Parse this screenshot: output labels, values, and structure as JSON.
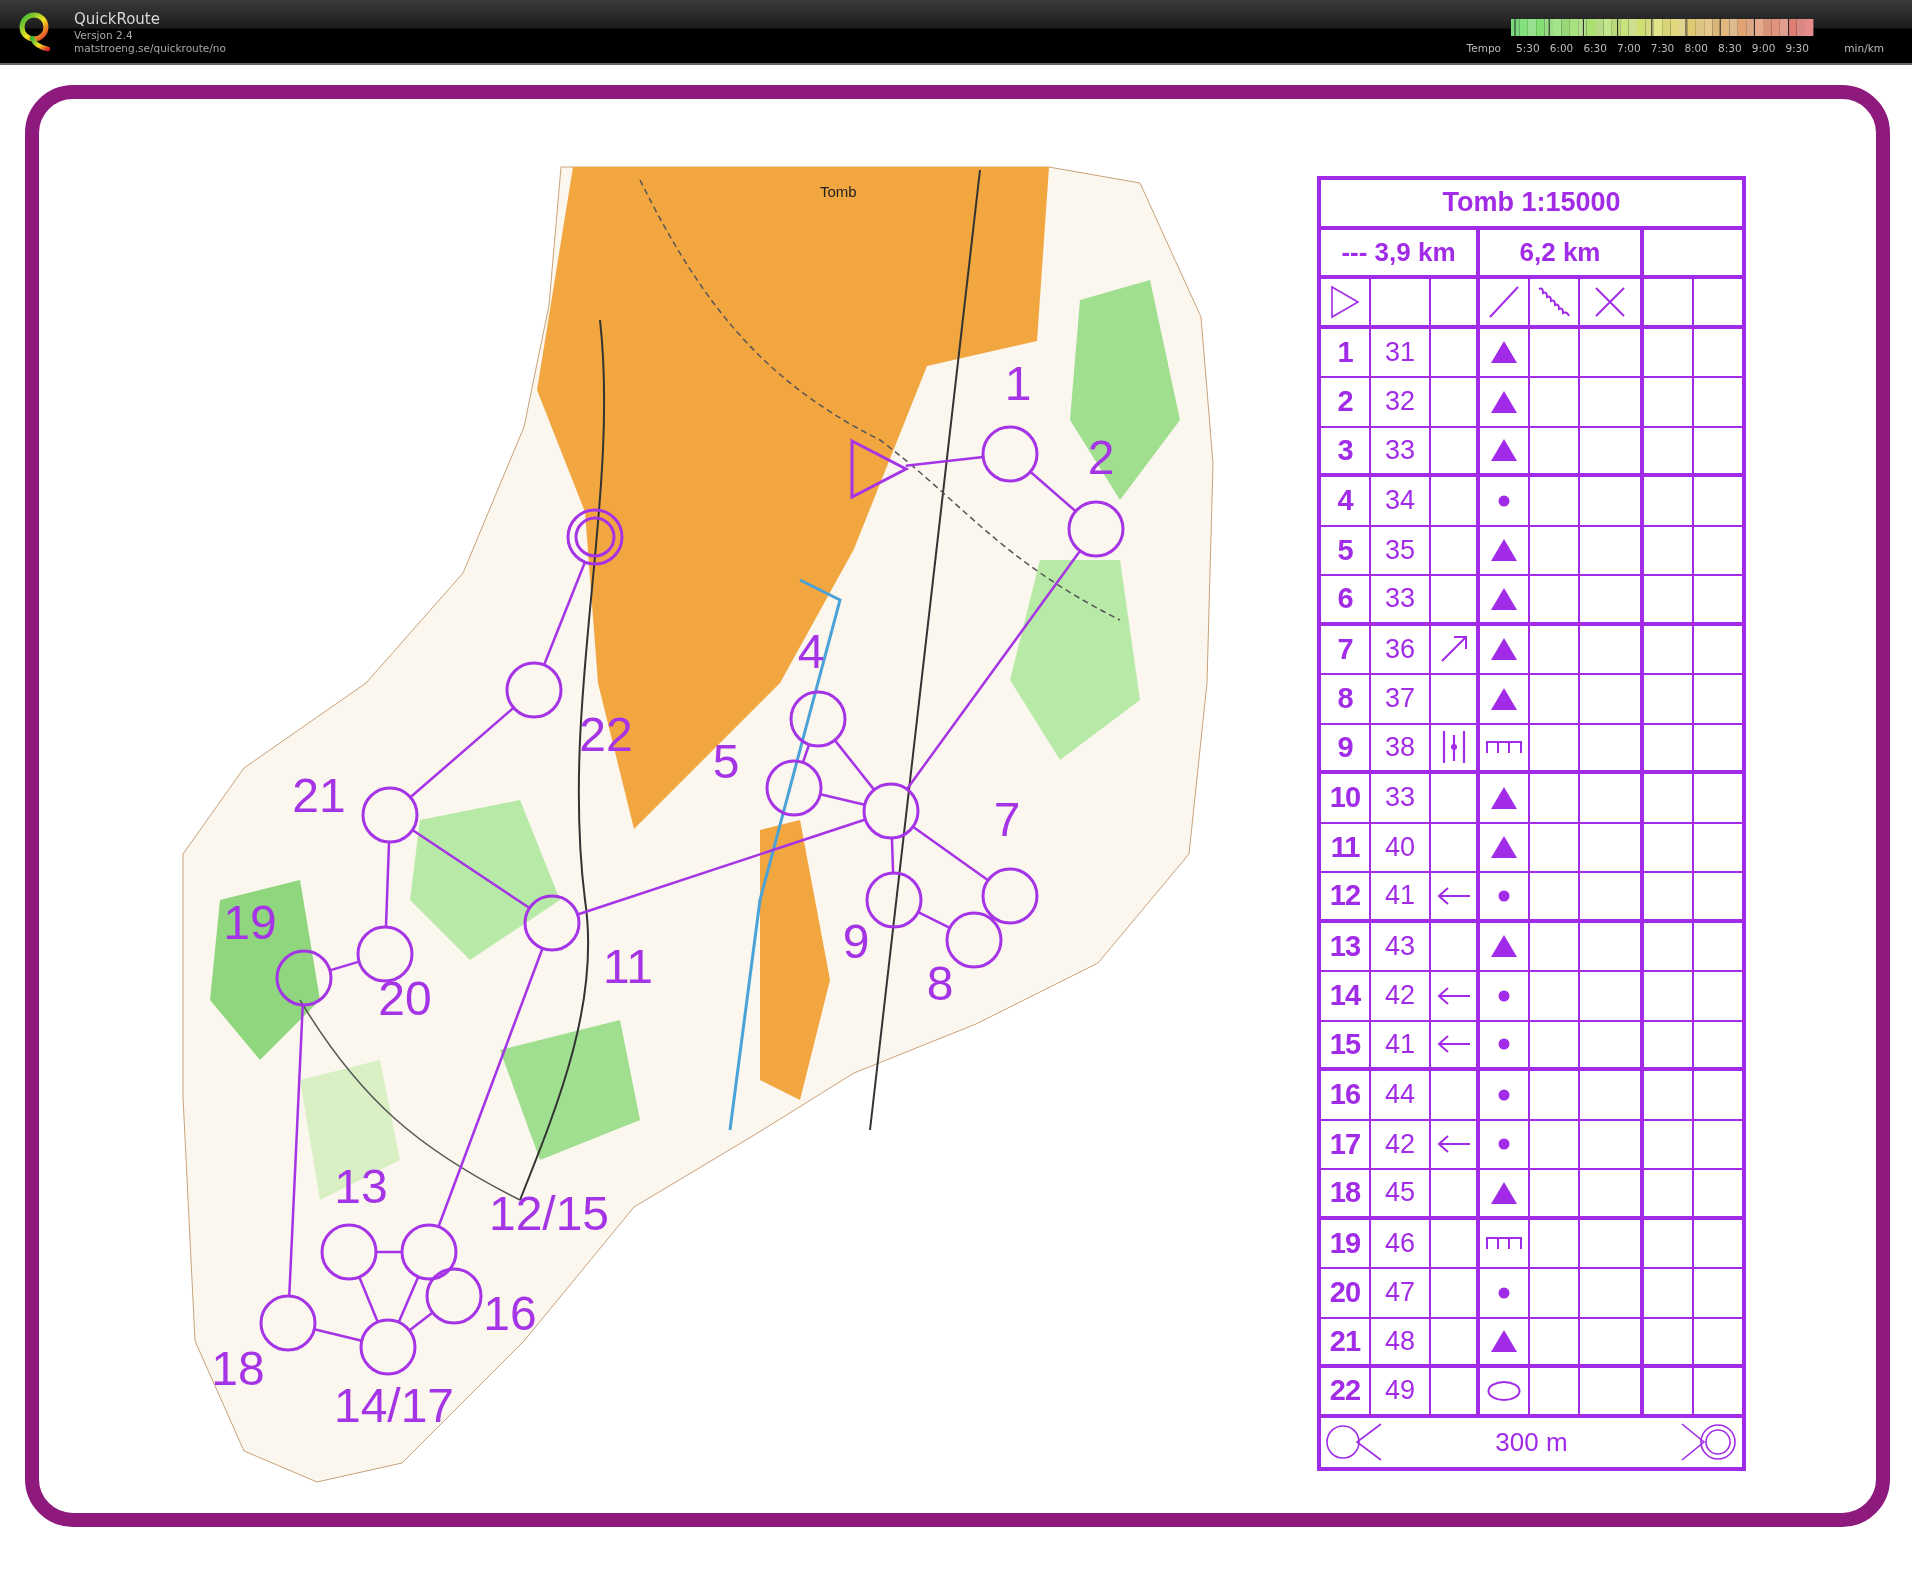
{
  "app_header": {
    "title": "QuickRoute",
    "version": "Versjon 2.4",
    "url": "matstroeng.se/quickroute/no",
    "tempo_legend": {
      "label": "Tempo",
      "ticks": [
        "5:30",
        "6:00",
        "6:30",
        "7:00",
        "7:30",
        "8:00",
        "8:30",
        "9:00",
        "9:30"
      ],
      "unit": "min/km"
    }
  },
  "map": {
    "place_label": "Tomb",
    "controls": [
      {
        "label": "1"
      },
      {
        "label": "2"
      },
      {
        "label": "4"
      },
      {
        "label": "5"
      },
      {
        "label": "7"
      },
      {
        "label": "8"
      },
      {
        "label": "9"
      },
      {
        "label": "11"
      },
      {
        "label": "12/15"
      },
      {
        "label": "13"
      },
      {
        "label": "14/17"
      },
      {
        "label": "16"
      },
      {
        "label": "18"
      },
      {
        "label": "19"
      },
      {
        "label": "20"
      },
      {
        "label": "21"
      },
      {
        "label": "22"
      }
    ]
  },
  "description_sheet": {
    "title": "Tomb 1:15000",
    "length_left": "--- 3,9 km",
    "length_right": "6,2 km",
    "rows": [
      {
        "number": "1",
        "code": "31",
        "feature": {
          "kind": "triangle"
        }
      },
      {
        "number": "2",
        "code": "32",
        "feature": {
          "kind": "triangle"
        }
      },
      {
        "number": "3",
        "code": "33",
        "feature": {
          "kind": "triangle"
        }
      },
      {
        "number": "4",
        "code": "34",
        "feature": {
          "kind": "dot"
        }
      },
      {
        "number": "5",
        "code": "35",
        "feature": {
          "kind": "triangle"
        }
      },
      {
        "number": "6",
        "code": "33",
        "feature": {
          "kind": "triangle"
        }
      },
      {
        "number": "7",
        "code": "36",
        "direction": {
          "kind": "northeast"
        },
        "feature": {
          "kind": "triangle"
        }
      },
      {
        "number": "8",
        "code": "37",
        "feature": {
          "kind": "triangle"
        }
      },
      {
        "number": "9",
        "code": "38",
        "direction": {
          "kind": "between"
        },
        "feature": {
          "kind": "comb"
        }
      },
      {
        "number": "10",
        "code": "33",
        "feature": {
          "kind": "triangle"
        }
      },
      {
        "number": "11",
        "code": "40",
        "feature": {
          "kind": "triangle"
        }
      },
      {
        "number": "12",
        "code": "41",
        "direction": {
          "kind": "west"
        },
        "feature": {
          "kind": "dot"
        }
      },
      {
        "number": "13",
        "code": "43",
        "feature": {
          "kind": "triangle"
        }
      },
      {
        "number": "14",
        "code": "42",
        "direction": {
          "kind": "west"
        },
        "feature": {
          "kind": "dot"
        }
      },
      {
        "number": "15",
        "code": "41",
        "direction": {
          "kind": "west"
        },
        "feature": {
          "kind": "dot"
        }
      },
      {
        "number": "16",
        "code": "44",
        "feature": {
          "kind": "dot"
        }
      },
      {
        "number": "17",
        "code": "42",
        "direction": {
          "kind": "west"
        },
        "feature": {
          "kind": "dot"
        }
      },
      {
        "number": "18",
        "code": "45",
        "feature": {
          "kind": "triangle"
        }
      },
      {
        "number": "19",
        "code": "46",
        "feature": {
          "kind": "comb"
        }
      },
      {
        "number": "20",
        "code": "47",
        "feature": {
          "kind": "dot"
        }
      },
      {
        "number": "21",
        "code": "48",
        "feature": {
          "kind": "triangle"
        }
      },
      {
        "number": "22",
        "code": "49",
        "feature": {
          "kind": "ellipse"
        }
      }
    ],
    "finish_distance": "300 m"
  }
}
